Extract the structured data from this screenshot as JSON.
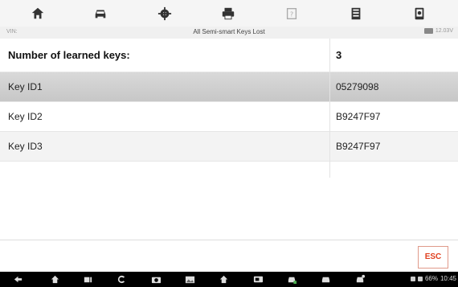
{
  "toolbar": {
    "icons": [
      "home-icon",
      "car-icon",
      "gear-icon",
      "print-icon",
      "help-icon",
      "save-icon",
      "screenshot-icon"
    ]
  },
  "infobar": {
    "vin_label": "VIN:",
    "title": "All Semi-smart Keys Lost",
    "voltage": "12.03V"
  },
  "table": {
    "header": {
      "label": "Number of learned keys:",
      "value": "3"
    },
    "rows": [
      {
        "label": "Key ID1",
        "value": "05279098"
      },
      {
        "label": "Key ID2",
        "value": "B9247F97"
      },
      {
        "label": "Key ID3",
        "value": "B9247F97"
      }
    ]
  },
  "actions": {
    "esc_label": "ESC"
  },
  "navbar": {
    "icons": [
      "back-icon",
      "home-icon",
      "recent-apps-icon",
      "refresh-icon",
      "camera-icon",
      "image-icon",
      "home-alt-icon",
      "vci-icon",
      "car-status-icon",
      "car-icon",
      "car-connect-icon"
    ],
    "status_text": "66%",
    "time": "10:45"
  },
  "colors": {
    "accent": "#e0401f",
    "selected_row": "#c9c9c9"
  }
}
